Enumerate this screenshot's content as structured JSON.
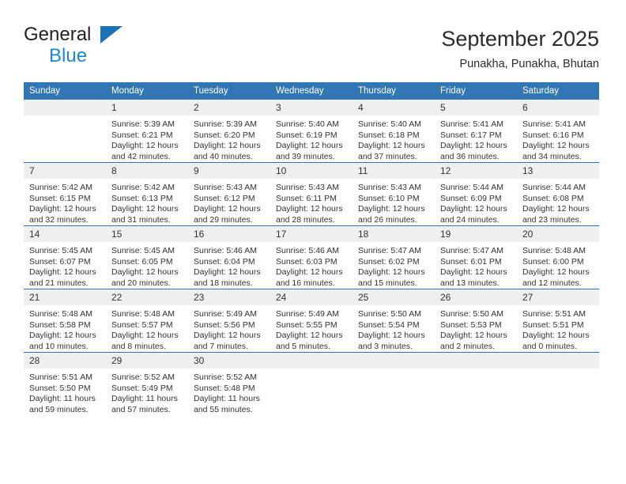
{
  "brand": {
    "name_top": "General",
    "name_bottom": "Blue",
    "triangle_color": "#1b72b8",
    "blue_color": "#1b86d8"
  },
  "header": {
    "title": "September 2025",
    "subtitle": "Punakha, Punakha, Bhutan"
  },
  "theme": {
    "header_blue": "#3277b4",
    "daynum_gray": "#efefef",
    "text": "#333333"
  },
  "calendar": {
    "weekday_headers": [
      "Sunday",
      "Monday",
      "Tuesday",
      "Wednesday",
      "Thursday",
      "Friday",
      "Saturday"
    ],
    "weeks": [
      [
        {
          "day": "",
          "empty": true
        },
        {
          "day": "1",
          "sunrise": "Sunrise: 5:39 AM",
          "sunset": "Sunset: 6:21 PM",
          "daylight_1": "Daylight: 12 hours",
          "daylight_2": "and 42 minutes."
        },
        {
          "day": "2",
          "sunrise": "Sunrise: 5:39 AM",
          "sunset": "Sunset: 6:20 PM",
          "daylight_1": "Daylight: 12 hours",
          "daylight_2": "and 40 minutes."
        },
        {
          "day": "3",
          "sunrise": "Sunrise: 5:40 AM",
          "sunset": "Sunset: 6:19 PM",
          "daylight_1": "Daylight: 12 hours",
          "daylight_2": "and 39 minutes."
        },
        {
          "day": "4",
          "sunrise": "Sunrise: 5:40 AM",
          "sunset": "Sunset: 6:18 PM",
          "daylight_1": "Daylight: 12 hours",
          "daylight_2": "and 37 minutes."
        },
        {
          "day": "5",
          "sunrise": "Sunrise: 5:41 AM",
          "sunset": "Sunset: 6:17 PM",
          "daylight_1": "Daylight: 12 hours",
          "daylight_2": "and 36 minutes."
        },
        {
          "day": "6",
          "sunrise": "Sunrise: 5:41 AM",
          "sunset": "Sunset: 6:16 PM",
          "daylight_1": "Daylight: 12 hours",
          "daylight_2": "and 34 minutes."
        }
      ],
      [
        {
          "day": "7",
          "sunrise": "Sunrise: 5:42 AM",
          "sunset": "Sunset: 6:15 PM",
          "daylight_1": "Daylight: 12 hours",
          "daylight_2": "and 32 minutes."
        },
        {
          "day": "8",
          "sunrise": "Sunrise: 5:42 AM",
          "sunset": "Sunset: 6:13 PM",
          "daylight_1": "Daylight: 12 hours",
          "daylight_2": "and 31 minutes."
        },
        {
          "day": "9",
          "sunrise": "Sunrise: 5:43 AM",
          "sunset": "Sunset: 6:12 PM",
          "daylight_1": "Daylight: 12 hours",
          "daylight_2": "and 29 minutes."
        },
        {
          "day": "10",
          "sunrise": "Sunrise: 5:43 AM",
          "sunset": "Sunset: 6:11 PM",
          "daylight_1": "Daylight: 12 hours",
          "daylight_2": "and 28 minutes."
        },
        {
          "day": "11",
          "sunrise": "Sunrise: 5:43 AM",
          "sunset": "Sunset: 6:10 PM",
          "daylight_1": "Daylight: 12 hours",
          "daylight_2": "and 26 minutes."
        },
        {
          "day": "12",
          "sunrise": "Sunrise: 5:44 AM",
          "sunset": "Sunset: 6:09 PM",
          "daylight_1": "Daylight: 12 hours",
          "daylight_2": "and 24 minutes."
        },
        {
          "day": "13",
          "sunrise": "Sunrise: 5:44 AM",
          "sunset": "Sunset: 6:08 PM",
          "daylight_1": "Daylight: 12 hours",
          "daylight_2": "and 23 minutes."
        }
      ],
      [
        {
          "day": "14",
          "sunrise": "Sunrise: 5:45 AM",
          "sunset": "Sunset: 6:07 PM",
          "daylight_1": "Daylight: 12 hours",
          "daylight_2": "and 21 minutes."
        },
        {
          "day": "15",
          "sunrise": "Sunrise: 5:45 AM",
          "sunset": "Sunset: 6:05 PM",
          "daylight_1": "Daylight: 12 hours",
          "daylight_2": "and 20 minutes."
        },
        {
          "day": "16",
          "sunrise": "Sunrise: 5:46 AM",
          "sunset": "Sunset: 6:04 PM",
          "daylight_1": "Daylight: 12 hours",
          "daylight_2": "and 18 minutes."
        },
        {
          "day": "17",
          "sunrise": "Sunrise: 5:46 AM",
          "sunset": "Sunset: 6:03 PM",
          "daylight_1": "Daylight: 12 hours",
          "daylight_2": "and 16 minutes."
        },
        {
          "day": "18",
          "sunrise": "Sunrise: 5:47 AM",
          "sunset": "Sunset: 6:02 PM",
          "daylight_1": "Daylight: 12 hours",
          "daylight_2": "and 15 minutes."
        },
        {
          "day": "19",
          "sunrise": "Sunrise: 5:47 AM",
          "sunset": "Sunset: 6:01 PM",
          "daylight_1": "Daylight: 12 hours",
          "daylight_2": "and 13 minutes."
        },
        {
          "day": "20",
          "sunrise": "Sunrise: 5:48 AM",
          "sunset": "Sunset: 6:00 PM",
          "daylight_1": "Daylight: 12 hours",
          "daylight_2": "and 12 minutes."
        }
      ],
      [
        {
          "day": "21",
          "sunrise": "Sunrise: 5:48 AM",
          "sunset": "Sunset: 5:58 PM",
          "daylight_1": "Daylight: 12 hours",
          "daylight_2": "and 10 minutes."
        },
        {
          "day": "22",
          "sunrise": "Sunrise: 5:48 AM",
          "sunset": "Sunset: 5:57 PM",
          "daylight_1": "Daylight: 12 hours",
          "daylight_2": "and 8 minutes."
        },
        {
          "day": "23",
          "sunrise": "Sunrise: 5:49 AM",
          "sunset": "Sunset: 5:56 PM",
          "daylight_1": "Daylight: 12 hours",
          "daylight_2": "and 7 minutes."
        },
        {
          "day": "24",
          "sunrise": "Sunrise: 5:49 AM",
          "sunset": "Sunset: 5:55 PM",
          "daylight_1": "Daylight: 12 hours",
          "daylight_2": "and 5 minutes."
        },
        {
          "day": "25",
          "sunrise": "Sunrise: 5:50 AM",
          "sunset": "Sunset: 5:54 PM",
          "daylight_1": "Daylight: 12 hours",
          "daylight_2": "and 3 minutes."
        },
        {
          "day": "26",
          "sunrise": "Sunrise: 5:50 AM",
          "sunset": "Sunset: 5:53 PM",
          "daylight_1": "Daylight: 12 hours",
          "daylight_2": "and 2 minutes."
        },
        {
          "day": "27",
          "sunrise": "Sunrise: 5:51 AM",
          "sunset": "Sunset: 5:51 PM",
          "daylight_1": "Daylight: 12 hours",
          "daylight_2": "and 0 minutes."
        }
      ],
      [
        {
          "day": "28",
          "sunrise": "Sunrise: 5:51 AM",
          "sunset": "Sunset: 5:50 PM",
          "daylight_1": "Daylight: 11 hours",
          "daylight_2": "and 59 minutes."
        },
        {
          "day": "29",
          "sunrise": "Sunrise: 5:52 AM",
          "sunset": "Sunset: 5:49 PM",
          "daylight_1": "Daylight: 11 hours",
          "daylight_2": "and 57 minutes."
        },
        {
          "day": "30",
          "sunrise": "Sunrise: 5:52 AM",
          "sunset": "Sunset: 5:48 PM",
          "daylight_1": "Daylight: 11 hours",
          "daylight_2": "and 55 minutes."
        },
        {
          "day": "",
          "empty": true
        },
        {
          "day": "",
          "empty": true
        },
        {
          "day": "",
          "empty": true
        },
        {
          "day": "",
          "empty": true
        }
      ]
    ]
  }
}
